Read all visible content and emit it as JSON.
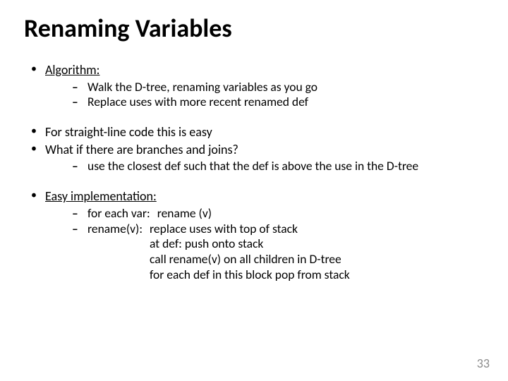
{
  "title": "Renaming Variables",
  "b1": {
    "algorithm_label": "Algorithm:",
    "algorithm_sub": {
      "s0": "Walk the D-tree, renaming variables as you go",
      "s1": "Replace uses with more recent renamed def"
    },
    "straight": "For straight-line code this is easy",
    "branches": "What if there are branches and joins?",
    "branches_sub": {
      "s0": "use the closest def such that the def is above the use in the D-tree"
    },
    "easy_label": "Easy implementation:",
    "easy_sub": {
      "s0_left": "for each var:",
      "s0_right": "rename (v)",
      "s1_left": "rename(v):",
      "s1_r0": "replace uses with top of stack",
      "s1_r1": "at def: push onto stack",
      "s1_r2": "call rename(v) on all children in D-tree",
      "s1_r3": "for each def in this block pop from stack"
    }
  },
  "page_number": "33"
}
